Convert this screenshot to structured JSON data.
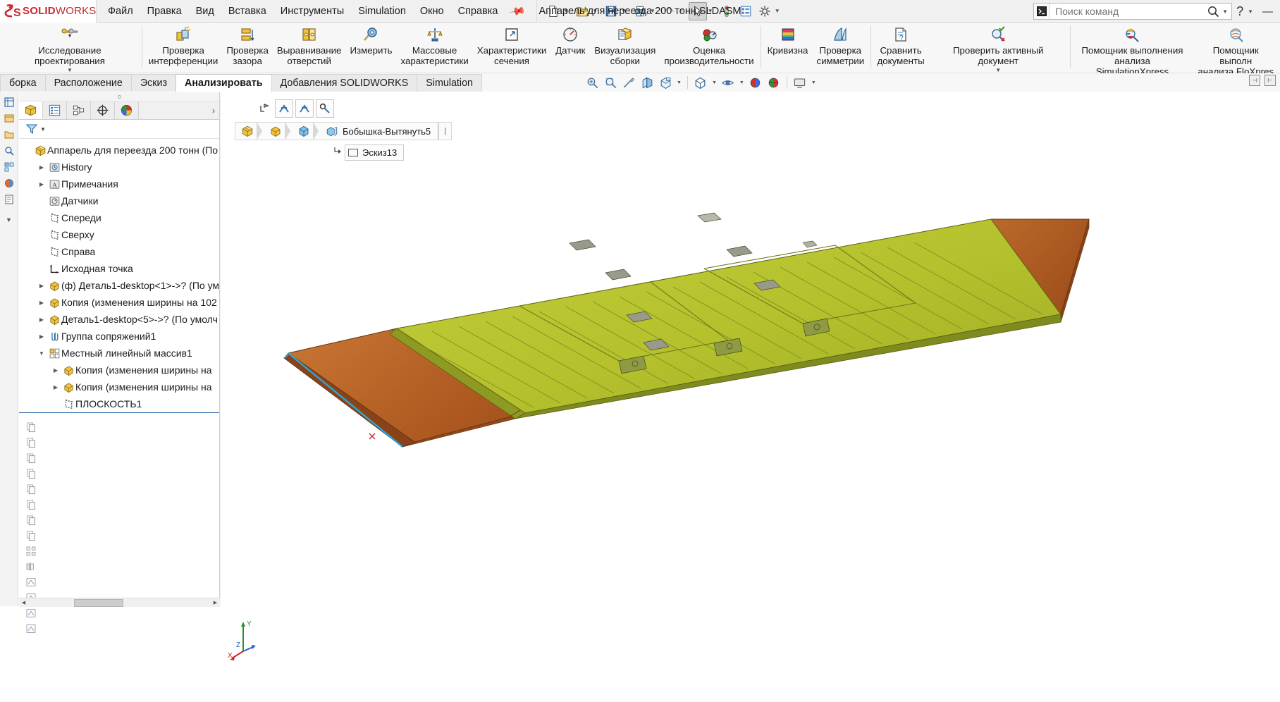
{
  "app": {
    "brand_ds": "DS",
    "brand_solid": "SOLID",
    "brand_works": "WORKS",
    "document_title": "Аппарель для переезда 200 тонн.SLDASM"
  },
  "menubar": {
    "items": [
      {
        "label": "Файл",
        "name": "menu-file"
      },
      {
        "label": "Правка",
        "name": "menu-edit"
      },
      {
        "label": "Вид",
        "name": "menu-view"
      },
      {
        "label": "Вставка",
        "name": "menu-insert"
      },
      {
        "label": "Инструменты",
        "name": "menu-tools"
      },
      {
        "label": "Simulation",
        "name": "menu-simulation"
      },
      {
        "label": "Окно",
        "name": "menu-window"
      },
      {
        "label": "Справка",
        "name": "menu-help"
      }
    ],
    "pin_icon": "pin-icon"
  },
  "quick_access": {
    "buttons": [
      {
        "name": "new-document-icon",
        "has_caret": true
      },
      {
        "name": "open-document-icon",
        "has_caret": true
      },
      {
        "name": "save-icon",
        "has_caret": true
      },
      {
        "name": "print-icon",
        "has_caret": true
      },
      {
        "name": "undo-icon",
        "has_caret": true,
        "disabled": true
      },
      {
        "name": "select-cursor-icon",
        "has_caret": true,
        "pressed": true
      },
      {
        "name": "rebuild-icon",
        "has_caret": false
      },
      {
        "name": "file-properties-icon",
        "has_caret": false
      },
      {
        "name": "options-gear-icon",
        "has_caret": true
      }
    ]
  },
  "search": {
    "placeholder": "Поиск команд",
    "command_icon": "command-prompt-icon",
    "magnifier_icon": "search-icon",
    "caret_icon": "chevron-down-icon"
  },
  "window_controls": {
    "help": "?",
    "help_caret": "chevron-down-icon",
    "minimize": "—"
  },
  "ribbon": {
    "groups": [
      {
        "name": "design-study-group",
        "commands": [
          {
            "label": "Исследование проектирования",
            "icon": "design-study-icon",
            "dropdown": true,
            "name": "design-study-button",
            "wide": true
          }
        ]
      },
      {
        "name": "evaluate-group",
        "commands": [
          {
            "label": "Проверка\nинтерференции",
            "icon": "interference-detection-icon",
            "name": "interference-detection-button"
          },
          {
            "label": "Проверка\nзазора",
            "icon": "clearance-verification-icon",
            "name": "clearance-verification-button"
          },
          {
            "label": "Выравнивание\nотверстий",
            "icon": "hole-alignment-icon",
            "name": "hole-alignment-button"
          },
          {
            "label": "Измерить",
            "icon": "measure-icon",
            "name": "measure-button"
          },
          {
            "label": "Массовые\nхарактеристики",
            "icon": "mass-properties-icon",
            "name": "mass-properties-button"
          },
          {
            "label": "Характеристики\nсечения",
            "icon": "section-properties-icon",
            "name": "section-properties-button"
          },
          {
            "label": "Датчик",
            "icon": "sensor-icon",
            "name": "sensor-button"
          },
          {
            "label": "Визуализация\nсборки",
            "icon": "assembly-visualization-icon",
            "name": "assembly-visualization-button"
          },
          {
            "label": "Оценка\nпроизводительности",
            "icon": "performance-evaluation-icon",
            "name": "performance-evaluation-button"
          }
        ]
      },
      {
        "name": "geometry-analysis-group",
        "commands": [
          {
            "label": "Кривизна",
            "icon": "curvature-icon",
            "name": "curvature-button"
          },
          {
            "label": "Проверка\nсимметрии",
            "icon": "symmetry-check-icon",
            "name": "symmetry-check-button"
          }
        ]
      },
      {
        "name": "compare-group",
        "commands": [
          {
            "label": "Сравнить\nдокументы",
            "icon": "compare-documents-icon",
            "name": "compare-documents-button"
          },
          {
            "label": "Проверить активный документ",
            "icon": "check-active-document-icon",
            "dropdown": true,
            "name": "check-active-document-button",
            "wide": true
          }
        ]
      },
      {
        "name": "xpress-group",
        "commands": [
          {
            "label": "Помощник выполнения\nанализа SimulationXpress",
            "icon": "simulationxpress-icon",
            "name": "simulationxpress-button",
            "wide": true
          },
          {
            "label": "Помощник выполн\nанализа FloXpres",
            "icon": "floxpress-icon",
            "name": "floxpress-button",
            "wide": true
          }
        ]
      }
    ]
  },
  "tabs": {
    "items": [
      {
        "label": "борка",
        "name": "tab-assembly",
        "active": false
      },
      {
        "label": "Расположение",
        "name": "tab-layout",
        "active": false
      },
      {
        "label": "Эскиз",
        "name": "tab-sketch",
        "active": false
      },
      {
        "label": "Анализировать",
        "name": "tab-evaluate",
        "active": true
      },
      {
        "label": "Добавления SOLIDWORKS",
        "name": "tab-solidworks-addins",
        "active": false
      },
      {
        "label": "Simulation",
        "name": "tab-simulation",
        "active": false
      }
    ]
  },
  "view_toolbar": {
    "buttons": [
      {
        "name": "zoom-to-fit-icon",
        "caret": false
      },
      {
        "name": "zoom-to-area-icon",
        "caret": false
      },
      {
        "name": "previous-view-icon",
        "caret": false
      },
      {
        "name": "section-view-icon",
        "caret": false
      },
      {
        "name": "view-orientation-icon",
        "caret": true
      },
      {
        "name": "display-style-icon",
        "caret": true,
        "sep_before": true
      },
      {
        "name": "hide-show-items-icon",
        "caret": true
      },
      {
        "name": "appearances-icon",
        "caret": false
      },
      {
        "name": "scene-icon",
        "caret": false
      },
      {
        "name": "view-settings-icon",
        "caret": true,
        "sep_before": true
      }
    ],
    "right_buttons": [
      {
        "name": "restore-panel-left-icon",
        "glyph": "⊣"
      },
      {
        "name": "restore-panel-right-icon",
        "glyph": "⊢"
      }
    ]
  },
  "tree_panel": {
    "tabs": [
      {
        "name": "feature-manager-tab",
        "icon": "feature-tree-icon",
        "active": true
      },
      {
        "name": "property-manager-tab",
        "icon": "property-manager-icon",
        "active": false
      },
      {
        "name": "configuration-manager-tab",
        "icon": "configuration-manager-icon",
        "active": false
      },
      {
        "name": "dimxpert-manager-tab",
        "icon": "dimxpert-icon",
        "active": false
      },
      {
        "name": "display-manager-tab",
        "icon": "display-manager-icon",
        "active": false
      }
    ],
    "expand_glyph": "›",
    "filter_icon": "filter-icon",
    "filter_caret": "chevron-down-icon",
    "nodes": [
      {
        "label": "Аппарель для переезда 200 тонн  (По",
        "icon": "assembly-icon",
        "indent": 0,
        "twisty": "none",
        "name": "tree-node-assembly-root"
      },
      {
        "label": "History",
        "icon": "history-icon",
        "indent": 1,
        "twisty": "collapsed",
        "name": "tree-node-history"
      },
      {
        "label": "Примечания",
        "icon": "annotations-icon",
        "indent": 1,
        "twisty": "collapsed",
        "name": "tree-node-annotations"
      },
      {
        "label": "Датчики",
        "icon": "sensors-folder-icon",
        "indent": 1,
        "twisty": "none",
        "name": "tree-node-sensors"
      },
      {
        "label": "Спереди",
        "icon": "plane-icon",
        "indent": 1,
        "twisty": "none",
        "name": "tree-node-front-plane"
      },
      {
        "label": "Сверху",
        "icon": "plane-icon",
        "indent": 1,
        "twisty": "none",
        "name": "tree-node-top-plane"
      },
      {
        "label": "Справа",
        "icon": "plane-icon",
        "indent": 1,
        "twisty": "none",
        "name": "tree-node-right-plane"
      },
      {
        "label": "Исходная точка",
        "icon": "origin-icon",
        "indent": 1,
        "twisty": "none",
        "name": "tree-node-origin"
      },
      {
        "label": "(ф) Деталь1-desktop<1>->? (По ум",
        "icon": "part-icon",
        "indent": 1,
        "twisty": "collapsed",
        "name": "tree-node-part1"
      },
      {
        "label": "Копия (изменения ширины на 102",
        "icon": "part-icon",
        "indent": 1,
        "twisty": "collapsed",
        "name": "tree-node-copy1"
      },
      {
        "label": "Деталь1-desktop<5>->? (По умолч",
        "icon": "part-icon",
        "indent": 1,
        "twisty": "collapsed",
        "name": "tree-node-part5"
      },
      {
        "label": "Группа сопряжений1",
        "icon": "mate-group-icon",
        "indent": 1,
        "twisty": "collapsed",
        "name": "tree-node-mategroup1"
      },
      {
        "label": "Местный линейный массив1",
        "icon": "local-linear-pattern-icon",
        "indent": 1,
        "twisty": "expanded",
        "name": "tree-node-linear-pattern1"
      },
      {
        "label": "Копия (изменения ширины на",
        "icon": "part-icon",
        "indent": 2,
        "twisty": "collapsed",
        "name": "tree-node-copy-a"
      },
      {
        "label": "Копия (изменения ширины на",
        "icon": "part-icon",
        "indent": 2,
        "twisty": "collapsed",
        "name": "tree-node-copy-b"
      },
      {
        "label": "ПЛОСКОСТЬ1",
        "icon": "plane-icon",
        "indent": 2,
        "twisty": "none",
        "name": "tree-node-plane1"
      }
    ],
    "lower_icons": [
      {
        "name": "copy-tool-icon"
      },
      {
        "name": "copy-tool-icon"
      },
      {
        "name": "copy-tool-icon"
      },
      {
        "name": "copy-tool-icon"
      },
      {
        "name": "copy-tool-icon"
      },
      {
        "name": "copy-tool-icon"
      },
      {
        "name": "copy-tool-icon"
      },
      {
        "name": "copy-tool-icon"
      },
      {
        "name": "pattern-tool-icon"
      },
      {
        "name": "mirror-tool-icon"
      },
      {
        "name": "sketch-tool-icon"
      },
      {
        "name": "sketch-tool-icon"
      },
      {
        "name": "sketch-tool-icon"
      },
      {
        "name": "sketch-tool-icon"
      }
    ]
  },
  "graphics": {
    "sketch_toolbar": {
      "exit_arrow_icon": "exit-sketch-icon",
      "buttons": [
        {
          "name": "add-relation-icon"
        },
        {
          "name": "display-delete-relations-icon"
        },
        {
          "name": "fully-define-sketch-icon"
        }
      ]
    },
    "breadcrumb": {
      "crumbs": [
        {
          "label": "",
          "icon": "assembly-icon",
          "name": "breadcrumb-assembly"
        },
        {
          "label": "",
          "icon": "part-icon",
          "name": "breadcrumb-part"
        },
        {
          "label": "",
          "icon": "solid-body-icon",
          "name": "breadcrumb-body"
        },
        {
          "label": "Бобышка-Вытянуть5",
          "icon": "extrude-boss-icon",
          "name": "breadcrumb-feature"
        }
      ],
      "caret": "|"
    },
    "sketch_chip": {
      "label": "Эскиз13",
      "icon": "sketch-icon",
      "name": "sketch-chip"
    },
    "triad": {
      "x_label": "X",
      "y_label": "Y",
      "z_label": "Z"
    },
    "model": {
      "description": "3D isometric assembly view of a 200-ton transfer ramp",
      "colors": {
        "deck": "#b8c32e",
        "deck_dark": "#9aa528",
        "ramp": "#b05a22",
        "ramp_light": "#c4702f",
        "edge": "#3a3a2a",
        "highlight": "#2fa8d8"
      }
    }
  },
  "scrollbar": {
    "left_arrow": "◀",
    "right_arrow": "▶"
  }
}
